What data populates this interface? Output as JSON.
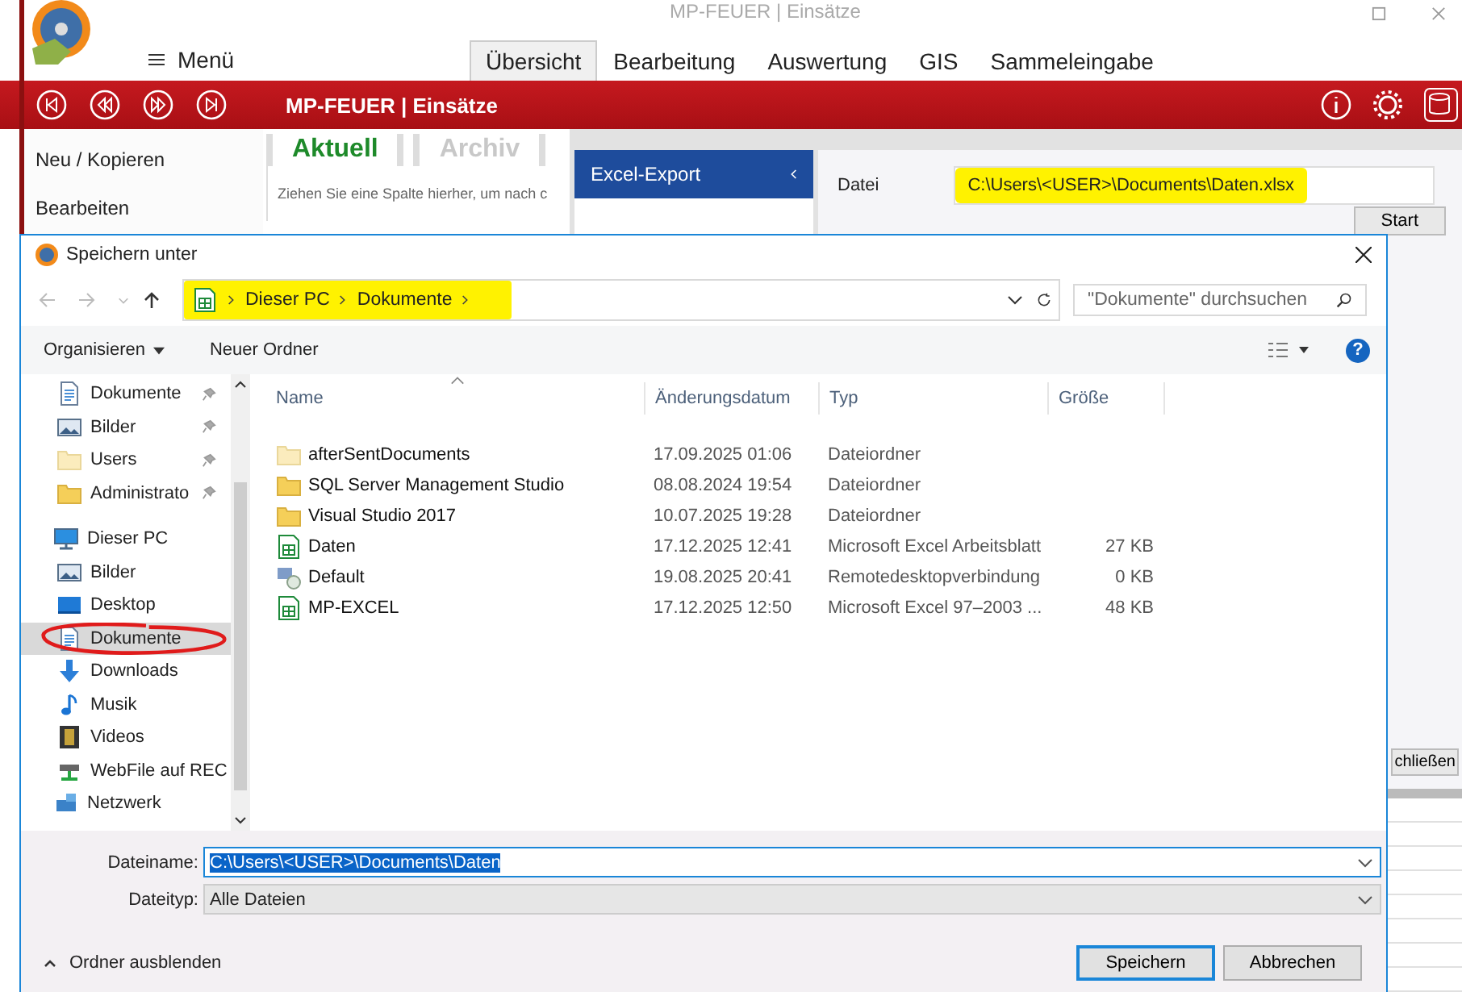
{
  "app": {
    "title": "MP-FEUER | Einsätze",
    "menu": "Menü",
    "ribbon_tabs": [
      {
        "label": "Übersicht",
        "selected": true
      },
      {
        "label": "Bearbeitung",
        "selected": false
      },
      {
        "label": "Auswertung",
        "selected": false
      },
      {
        "label": "GIS",
        "selected": false
      },
      {
        "label": "Sammeleingabe",
        "selected": false
      }
    ],
    "module_title": "MP-FEUER | Einsätze",
    "side_actions": [
      "Neu / Kopieren",
      "Bearbeiten"
    ],
    "grid_tabs": [
      {
        "label": "Aktuell",
        "selected": true
      },
      {
        "label": "Archiv",
        "selected": false
      }
    ],
    "group_hint": "Ziehen Sie eine Spalte hierher, um nach c",
    "export_items": [
      {
        "label": "Excel-Export",
        "selected": true
      }
    ],
    "file": {
      "label": "Datei",
      "value": "C:\\Users\\<USER>\\Documents\\Daten.xlsx",
      "highlighted": true
    },
    "start_button": "Start",
    "close_button": "chließen"
  },
  "dialog": {
    "title": "Speichern unter",
    "address": {
      "path": [
        "Dieser PC",
        "Dokumente"
      ],
      "highlighted": true
    },
    "search": {
      "placeholder": "\"Dokumente\" durchsuchen"
    },
    "toolbar": {
      "organize": "Organisieren",
      "new_folder": "Neuer Ordner",
      "help": "?"
    },
    "quick_access": [
      {
        "label": "Dokumente",
        "kind": "doc",
        "pinned": true,
        "selected": false
      },
      {
        "label": "Bilder",
        "kind": "picture",
        "pinned": true,
        "selected": false
      },
      {
        "label": "Users",
        "kind": "folder-light",
        "pinned": true,
        "selected": false
      },
      {
        "label": "Administrato",
        "kind": "folder",
        "pinned": true,
        "selected": false
      }
    ],
    "locations": [
      {
        "label": "Dieser PC",
        "kind": "pc",
        "selected": false,
        "circled": false,
        "children": [
          {
            "label": "Bilder",
            "kind": "picture",
            "selected": false,
            "circled": false
          },
          {
            "label": "Desktop",
            "kind": "desktop",
            "selected": false,
            "circled": false
          },
          {
            "label": "Dokumente",
            "kind": "doc",
            "selected": true,
            "circled": true
          },
          {
            "label": "Downloads",
            "kind": "download",
            "selected": false,
            "circled": false
          },
          {
            "label": "Musik",
            "kind": "music",
            "selected": false,
            "circled": false
          },
          {
            "label": "Videos",
            "kind": "video",
            "selected": false,
            "circled": false
          },
          {
            "label": "WebFile auf REC",
            "kind": "netdrive",
            "selected": false,
            "circled": false
          }
        ]
      },
      {
        "label": "Netzwerk",
        "kind": "network",
        "selected": false,
        "circled": false
      }
    ],
    "columns": [
      "Name",
      "Änderungsdatum",
      "Typ",
      "Größe"
    ],
    "files": [
      {
        "name": "afterSentDocuments",
        "date": "17.09.2025 01:06",
        "type": "Dateiordner",
        "kind": "folder-light"
      },
      {
        "name": "SQL Server Management Studio",
        "date": "08.08.2024 19:54",
        "type": "Dateiordner",
        "kind": "folder"
      },
      {
        "name": "Visual Studio 2017",
        "date": "10.07.2025 19:28",
        "type": "Dateiordner",
        "kind": "folder"
      },
      {
        "name": "Daten",
        "date": "17.12.2025 12:41",
        "type": "Microsoft Excel Arbeitsblatt",
        "size": "27 KB",
        "kind": "excel"
      },
      {
        "name": "Default",
        "date": "19.08.2025 20:41",
        "type": "Remotedesktopverbindung",
        "size": "0 KB",
        "kind": "rdp"
      },
      {
        "name": "MP-EXCEL",
        "date": "17.12.2025 12:50",
        "type": "Microsoft Excel 97–2003 ...",
        "size": "48 KB",
        "kind": "excel"
      }
    ],
    "file_name": {
      "label": "Dateiname:",
      "value": "C:\\Users\\<USER>\\Documents\\Daten",
      "text_selected": true
    },
    "file_type": {
      "label": "Dateityp:",
      "value": "Alle Dateien"
    },
    "hide_folders": "Ordner ausblenden",
    "buttons": [
      "Speichern",
      "Abbrechen"
    ]
  }
}
